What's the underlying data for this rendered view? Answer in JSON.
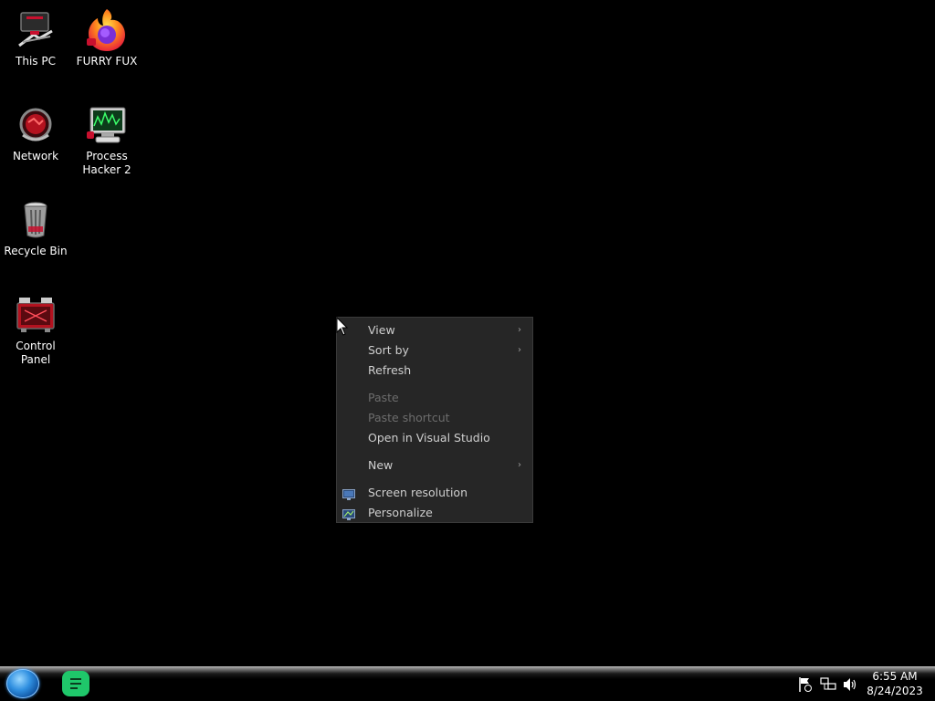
{
  "desktop": {
    "icons": [
      {
        "label": "This PC",
        "icon": "this-pc-icon"
      },
      {
        "label": "FURRY FUX",
        "icon": "firefox-icon"
      },
      {
        "label": "Network",
        "icon": "network-icon"
      },
      {
        "label": "Process\nHacker 2",
        "line1": "Process",
        "line2": "Hacker 2",
        "icon": "process-hacker-icon"
      },
      {
        "label": "Recycle Bin",
        "icon": "recycle-bin-icon"
      },
      {
        "label": "Control Panel",
        "icon": "control-panel-icon"
      }
    ]
  },
  "context_menu": {
    "items": [
      {
        "label": "View",
        "enabled": true,
        "submenu": true
      },
      {
        "label": "Sort by",
        "enabled": true,
        "submenu": true
      },
      {
        "label": "Refresh",
        "enabled": true,
        "submenu": false
      },
      {
        "label": "Paste",
        "enabled": false,
        "submenu": false
      },
      {
        "label": "Paste shortcut",
        "enabled": false,
        "submenu": false
      },
      {
        "label": "Open in Visual Studio",
        "enabled": true,
        "submenu": false
      },
      {
        "label": "New",
        "enabled": true,
        "submenu": true
      },
      {
        "label": "Screen resolution",
        "enabled": true,
        "submenu": false,
        "icon": "display-icon"
      },
      {
        "label": "Personalize",
        "enabled": true,
        "submenu": false,
        "icon": "personalize-icon"
      }
    ],
    "submenu_arrow": "›"
  },
  "taskbar": {
    "start_icon": "start-orb-icon",
    "pinned_app_icon": "notes-app-icon",
    "tray_icons": [
      "action-center-flag-icon",
      "network-tray-icon",
      "volume-icon"
    ],
    "clock": {
      "time": "6:55 AM",
      "date": "8/24/2023"
    }
  },
  "colors": {
    "desktop_bg": "#000000",
    "menu_bg": "#262626",
    "menu_text": "#cfcfcf",
    "menu_disabled_text": "#6c6c6c",
    "start_orb": "#2f8fe0",
    "notes_app": "#1fc76a"
  }
}
